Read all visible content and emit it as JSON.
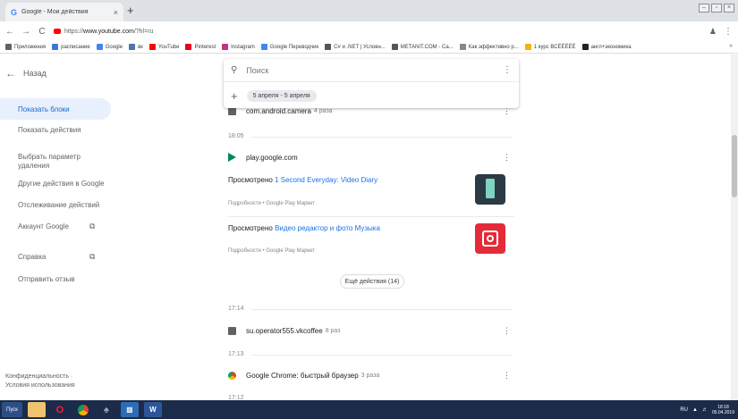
{
  "browser": {
    "tab_title": "Google - Мои действия",
    "tab_favicon": "G",
    "tab_close": "×",
    "new_tab": "+",
    "url_prefix": "https://",
    "url_host": "www.youtube.com",
    "url_path": "/?hl=ru",
    "nav": {
      "back": "←",
      "forward": "→",
      "reload": "C"
    },
    "menu_glyph": "⋮",
    "bookmarks": [
      {
        "label": "Приложения",
        "color": "#5f6368"
      },
      {
        "label": "расписание",
        "color": "#3c78d8"
      },
      {
        "label": "Google",
        "color": "#4285f4"
      },
      {
        "label": "вк",
        "color": "#4a76a8"
      },
      {
        "label": "YouTube",
        "color": "#ff0000"
      },
      {
        "label": "Pinterest",
        "color": "#e60023"
      },
      {
        "label": "Instagram",
        "color": "#c13584"
      },
      {
        "label": "Google Переводчик",
        "color": "#4285f4"
      },
      {
        "label": "C# и .NET | Условн...",
        "color": "#555555"
      },
      {
        "label": "METANIT.COM - Са...",
        "color": "#555555"
      },
      {
        "label": "Как эффективно р...",
        "color": "#888888"
      },
      {
        "label": "1 курс ВСЁЁЁЁЁ",
        "color": "#f4b400"
      },
      {
        "label": "англ+экономика",
        "color": "#222222"
      }
    ],
    "bookmarks_more": "»"
  },
  "sidebar": {
    "back_label": "Назад",
    "items": [
      {
        "label": "Показать блоки",
        "active": true
      },
      {
        "label": "Показать действия"
      },
      {
        "label": "Выбрать параметр удаления"
      },
      {
        "label": "Другие действия в Google"
      },
      {
        "label": "Отслеживание действий"
      },
      {
        "label": "Аккаунт Google",
        "external": true
      },
      {
        "label": "Справка",
        "external": true
      },
      {
        "label": "Отправить отзыв"
      }
    ],
    "footer_privacy": "Конфиденциальность ·",
    "footer_terms": "Условия использования"
  },
  "search": {
    "placeholder": "Поиск",
    "filter_chip": "5 апреля - 5 апреля"
  },
  "feed": {
    "camera": {
      "name": "com.android.camera",
      "count": "4 раза"
    },
    "time1": "18:05",
    "play": {
      "name": "play.google.com"
    },
    "entry1": {
      "prefix": "Просмотрено ",
      "link": "1 Second Everyday: Video Diary",
      "details": "Подробности • Google Play Маркет",
      "thumb_color": "#2b3a45"
    },
    "entry2": {
      "prefix": "Просмотрено ",
      "link": "Видео редактор и фото Музыка",
      "details": "Подробности • Google Play Маркет",
      "thumb_color": "#e32b3a"
    },
    "more_button": "Ещё действия (14)",
    "time2": "17:14",
    "vk": {
      "name": "su.operator555.vkcoffee",
      "count": "8 раз"
    },
    "time3": "17:13",
    "chrome": {
      "name": "Google Chrome: быстрый браузер",
      "count": "3 раза"
    },
    "time4": "17:12"
  },
  "taskbar": {
    "start_label": "Пуск",
    "lang": "RU",
    "time": "18:18",
    "date": "05.04.2019"
  }
}
